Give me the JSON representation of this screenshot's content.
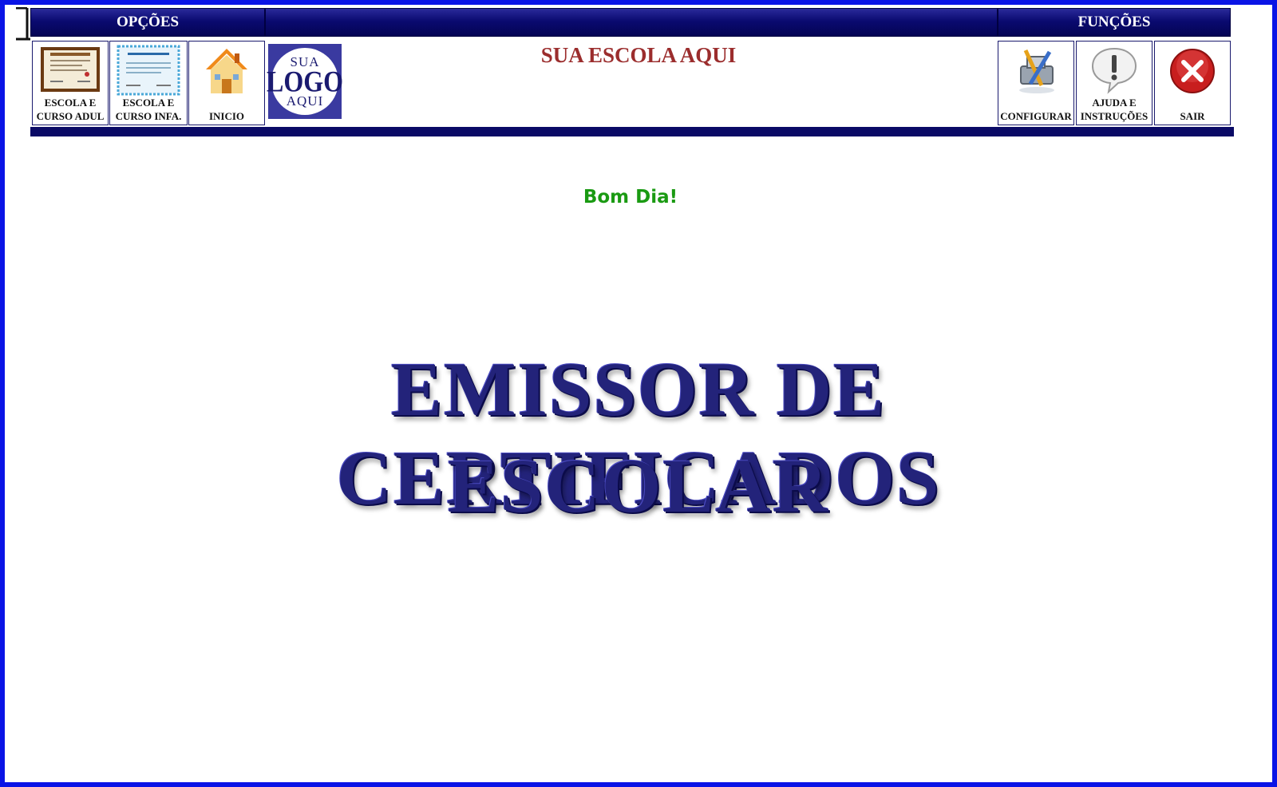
{
  "header": {
    "left_title": "OPÇÕES",
    "right_title": "FUNÇÕES",
    "school_name": "SUA ESCOLA AQUI"
  },
  "options": [
    {
      "label": "ESCOLA E\nCURSO  ADUL",
      "icon": "certificate-brown-icon"
    },
    {
      "label": "ESCOLA E\nCURSO INFA.",
      "icon": "certificate-blue-icon"
    },
    {
      "label": "INICIO",
      "icon": "home-icon"
    }
  ],
  "logo": {
    "line1": "SUA",
    "line2": "LOGO",
    "line3": "AQUI"
  },
  "functions": [
    {
      "label": "CONFIGURAR",
      "icon": "settings-tools-icon"
    },
    {
      "label": "AJUDA E\nINSTRUÇÕES",
      "icon": "help-exclamation-icon"
    },
    {
      "label": "SAIR",
      "icon": "exit-x-icon"
    }
  ],
  "greeting": "Bom Dia!",
  "title": {
    "line1": "EMISSOR DE CERTIFICADOS",
    "line2": "ESCOLAR"
  },
  "colors": {
    "frame": "#0a14e6",
    "bar": "#0a0a70",
    "school": "#9b2d2d",
    "greeting": "#1a9a12",
    "title": "#23237a"
  }
}
